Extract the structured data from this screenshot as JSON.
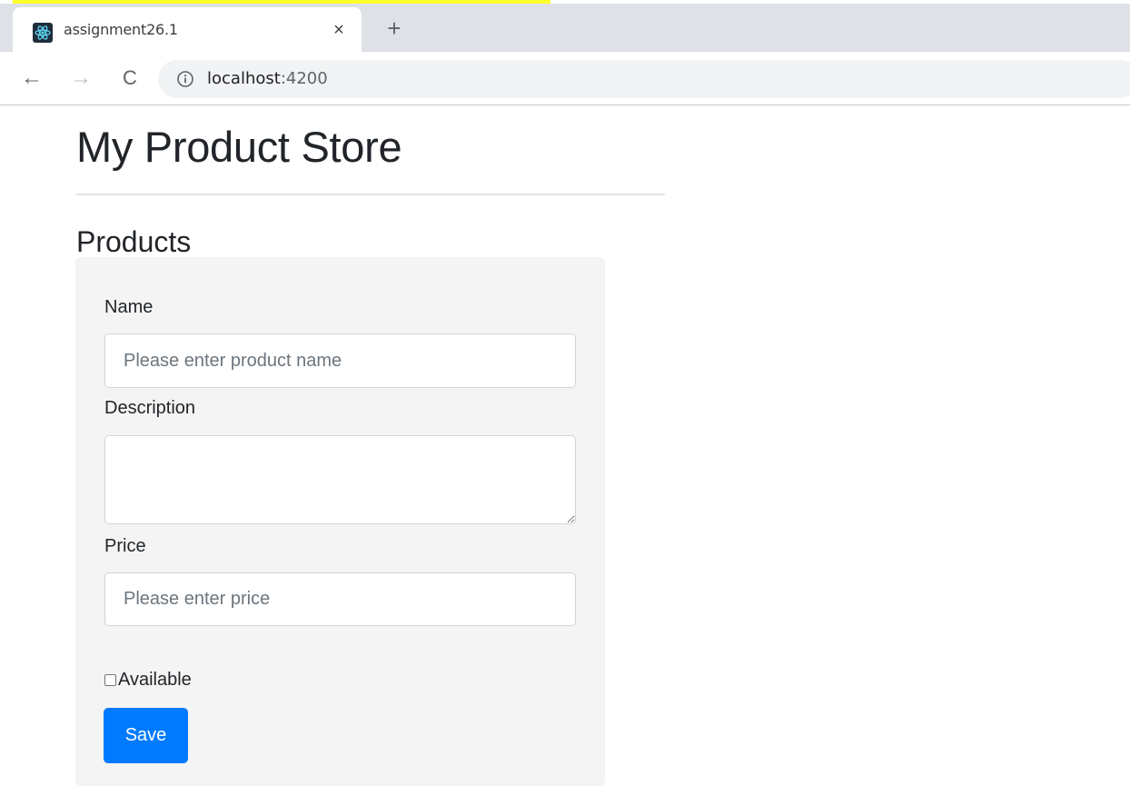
{
  "browser": {
    "tab": {
      "title": "assignment26.1",
      "close_glyph": "×",
      "favicon": "react-atom-icon"
    },
    "new_tab_glyph": "+",
    "nav": {
      "back_glyph": "←",
      "forward_glyph": "→",
      "reload_glyph": "C"
    },
    "address": {
      "host": "localhost",
      "port": ":4200",
      "info_icon": "info-icon"
    }
  },
  "page": {
    "title": "My Product Store",
    "section_title": "Products"
  },
  "form": {
    "name_label": "Name",
    "name_placeholder": "Please enter product name",
    "name_value": "",
    "description_label": "Description",
    "description_value": "",
    "price_label": "Price",
    "price_placeholder": "Please enter price",
    "price_value": "",
    "available_label": "Available",
    "available_checked": false,
    "save_label": "Save"
  },
  "colors": {
    "highlight": "#ffff2a",
    "primary_button": "#007bff",
    "card_background": "#f4f4f4"
  }
}
